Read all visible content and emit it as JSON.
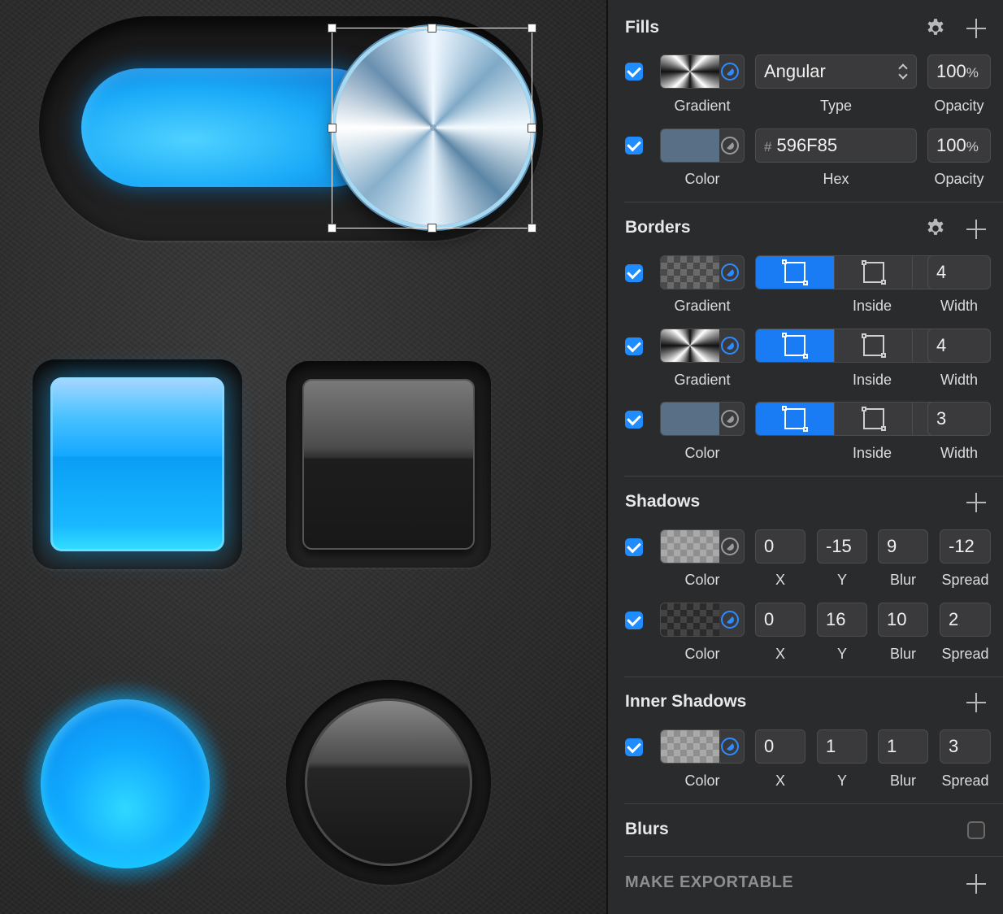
{
  "inspector": {
    "fills": {
      "title": "Fills",
      "rows": [
        {
          "type_value": "Angular",
          "opacity_value": "100",
          "opacity_suffix": "%",
          "labels": [
            "Gradient",
            "Type",
            "Opacity"
          ]
        },
        {
          "hex_prefix": "#",
          "hex_value": "596F85",
          "opacity_value": "100",
          "opacity_suffix": "%",
          "labels": [
            "Color",
            "Hex",
            "Opacity"
          ],
          "swatch_color": "#596F85"
        }
      ]
    },
    "borders": {
      "title": "Borders",
      "rows": [
        {
          "width": "4",
          "labels": [
            "Gradient",
            "Inside",
            "Width"
          ]
        },
        {
          "width": "4",
          "labels": [
            "Gradient",
            "Inside",
            "Width"
          ]
        },
        {
          "width": "3",
          "labels": [
            "Color",
            "Inside",
            "Width"
          ],
          "swatch_color": "#596F85"
        }
      ]
    },
    "shadows": {
      "title": "Shadows",
      "rows": [
        {
          "x": "0",
          "y": "-15",
          "blur": "9",
          "spread": "-12",
          "labels": [
            "Color",
            "X",
            "Y",
            "Blur",
            "Spread"
          ]
        },
        {
          "x": "0",
          "y": "16",
          "blur": "10",
          "spread": "2",
          "labels": [
            "Color",
            "X",
            "Y",
            "Blur",
            "Spread"
          ]
        }
      ]
    },
    "inner_shadows": {
      "title": "Inner Shadows",
      "rows": [
        {
          "x": "0",
          "y": "1",
          "blur": "1",
          "spread": "3",
          "labels": [
            "Color",
            "X",
            "Y",
            "Blur",
            "Spread"
          ]
        }
      ]
    },
    "blurs": {
      "title": "Blurs"
    },
    "export": {
      "title": "MAKE EXPORTABLE"
    }
  },
  "colors": {
    "accent": "#1F8CFF",
    "fill_color": "#596F85",
    "panel_bg": "#2A2B2D",
    "glow_blue": "#14A8FF"
  },
  "icons": [
    "gear-icon",
    "plus-icon",
    "checkbox-checked",
    "color-mode-icon",
    "border-inside-icon",
    "border-center-icon",
    "border-outside-icon"
  ]
}
